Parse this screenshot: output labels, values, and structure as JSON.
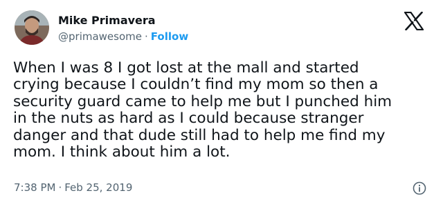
{
  "author": {
    "name": "Mike Primavera",
    "handle": "@primawesome",
    "separator": "·",
    "follow_label": "Follow"
  },
  "brand": {
    "logo": "x-logo-icon",
    "accent": "#1d9bf0",
    "text": "#0f1419",
    "muted": "#536471"
  },
  "tweet": {
    "lines": [
      "When I was 8 I got lost at the mall and started",
      "crying because I couldn’t find my mom so then a",
      "security guard came to help me but I punched him",
      "in the nuts as hard as I could because stranger",
      "danger and that dude still had to help me find my",
      "mom. I think about him a lot."
    ]
  },
  "meta": {
    "time": "7:38 PM",
    "separator": "·",
    "date": "Feb 25, 2019",
    "info_icon": "info-icon"
  }
}
